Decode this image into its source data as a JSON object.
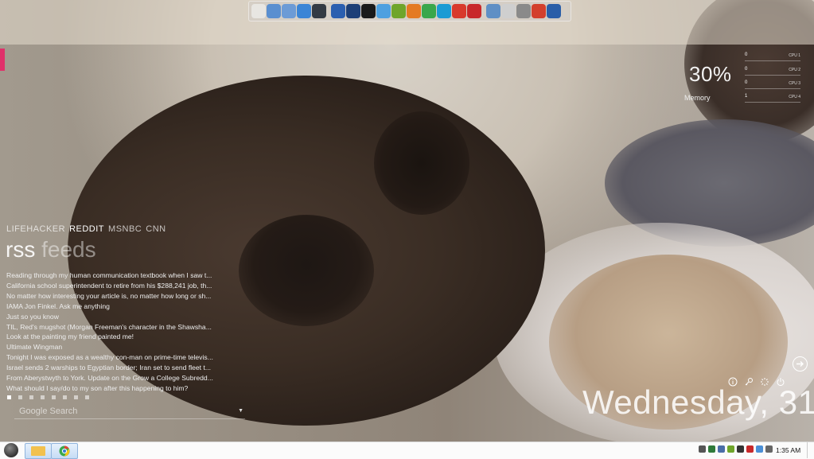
{
  "dock": {
    "icons": [
      {
        "name": "blank-doc-icon",
        "color": "#e8e6e2"
      },
      {
        "name": "folder-open-icon",
        "color": "#5a8fd0"
      },
      {
        "name": "folder-open-2-icon",
        "color": "#6c9bd6"
      },
      {
        "name": "dropbox-icon",
        "color": "#3b85d6"
      },
      {
        "name": "steam-icon",
        "color": "#333a44"
      },
      {
        "sep": true
      },
      {
        "name": "word-icon",
        "color": "#2b5fb0"
      },
      {
        "name": "photoshop-icon",
        "color": "#1d3f77"
      },
      {
        "name": "media-disc-icon",
        "color": "#1a1a1a"
      },
      {
        "name": "itunes-icon",
        "color": "#4ea0e0"
      },
      {
        "name": "spotify-icon",
        "color": "#6fa52b"
      },
      {
        "name": "firefox-icon",
        "color": "#e47a22"
      },
      {
        "name": "chrome-icon",
        "color": "#3aa74c"
      },
      {
        "name": "virtualbox-icon",
        "color": "#1b9bd4"
      },
      {
        "name": "xmarks-icon",
        "color": "#d83a2c"
      },
      {
        "name": "puzzle-red-icon",
        "color": "#c8282a"
      },
      {
        "sep": true
      },
      {
        "name": "eye-icon",
        "color": "#5f8fc5"
      },
      {
        "name": "notes-icon",
        "color": "#cfcfcf"
      },
      {
        "name": "tools-icon",
        "color": "#8a8a8a"
      },
      {
        "name": "ccleaner-icon",
        "color": "#d3402d"
      },
      {
        "name": "database-icon",
        "color": "#2a5ea8"
      }
    ]
  },
  "system": {
    "cpu_percent": "30%",
    "memory_label": "Memory",
    "cpu_rows": [
      {
        "value": "0",
        "label": "CPU 1"
      },
      {
        "value": "0",
        "label": "CPU 2"
      },
      {
        "value": "0",
        "label": "CPU 3"
      },
      {
        "value": "1",
        "label": "CPU 4"
      }
    ]
  },
  "rss": {
    "tabs": [
      {
        "label": "LIFEHACKER",
        "active": false
      },
      {
        "label": "REDDIT",
        "active": true
      },
      {
        "label": "MSNBC",
        "active": false
      },
      {
        "label": "CNN",
        "active": false
      }
    ],
    "title_a": "rss",
    "title_b": " feeds",
    "items": [
      "Reading through my human communication textbook when I saw t...",
      "California school superintendent to retire from his $288,241 job, th...",
      "No matter how interesting your article is, no matter how long or sh...",
      "IAMA Jon Finkel. Ask me anything",
      "Just so you know",
      "TIL, Red's mugshot (Morgan Freeman's character in the Shawsha...",
      "Look at the painting my friend painted me!",
      "Ultimate Wingman",
      "Tonight I was exposed as a wealthy con-man on prime-time televis...",
      "Israel sends 2 warships to Egyptian border; Iran set to send fleet t...",
      "From Aberystwyth to York. Update on the Grow a College Subredd...",
      "What should I say/do to my son after this happening to him?"
    ],
    "page_count": 8,
    "active_page": 1
  },
  "search": {
    "placeholder": "Google Search"
  },
  "clock": {
    "day": "Wednesday, 31",
    "time": "1:35 AM"
  },
  "taskbar": {
    "buttons": [
      {
        "name": "explorer-icon",
        "color": "#f2c14e"
      },
      {
        "name": "chrome-icon",
        "color": "#3aa74c"
      }
    ],
    "tray_icons": [
      {
        "name": "clock-tray-icon",
        "color": "#555555"
      },
      {
        "name": "network-tray-icon",
        "color": "#2f7a3a"
      },
      {
        "name": "monitor-tray-icon",
        "color": "#4a6ea8"
      },
      {
        "name": "spotify-tray-icon",
        "color": "#6fa52b"
      },
      {
        "name": "display-tray-icon",
        "color": "#333333"
      },
      {
        "name": "app-tray-icon",
        "color": "#c8282a"
      },
      {
        "name": "flag-tray-icon",
        "color": "#4b8fd6"
      },
      {
        "name": "volume-tray-icon",
        "color": "#666666"
      }
    ]
  }
}
